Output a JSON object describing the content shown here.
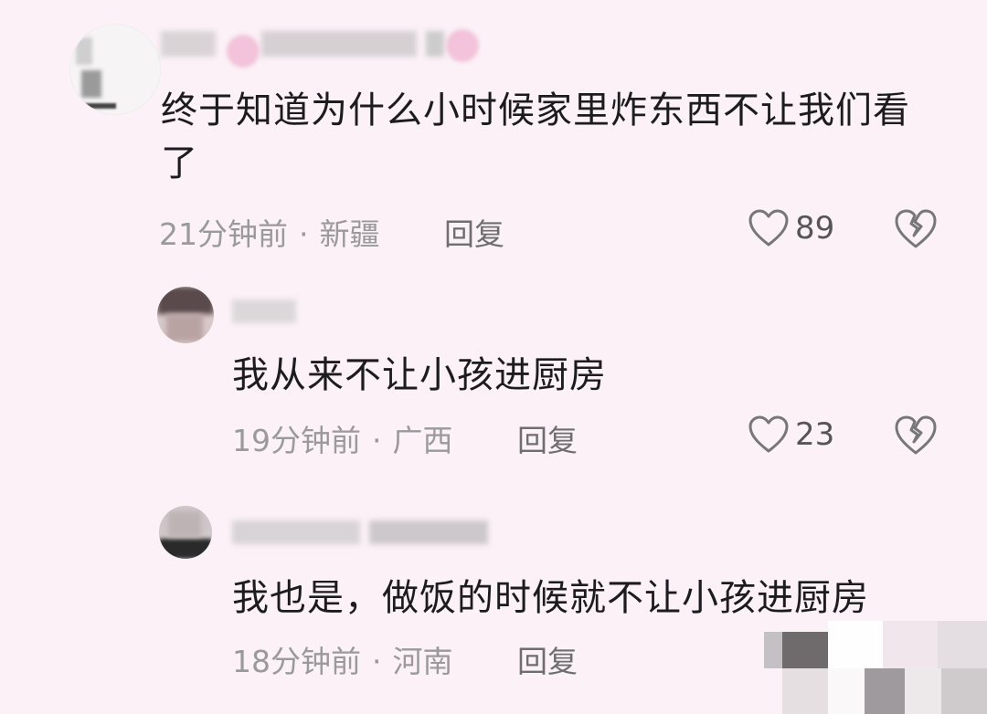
{
  "comments": [
    {
      "text": "终于知道为什么小时候家里炸东西不让我们看了",
      "time": "21分钟前",
      "location": "新疆",
      "reply_label": "回复",
      "likes": "89"
    },
    {
      "text": "我从来不让小孩进厨房",
      "time": "19分钟前",
      "location": "广西",
      "reply_label": "回复",
      "likes": "23"
    },
    {
      "text": "我也是，做饭的时候就不让小孩进厨房",
      "time": "18分钟前",
      "location": "河南",
      "reply_label": "回复"
    }
  ],
  "separator": "·",
  "icons": {
    "like": "heart-outline-icon",
    "dislike": "broken-heart-icon"
  },
  "colors": {
    "background": "#fbf1f6",
    "text": "#1c1c1c",
    "meta": "#9a9a9a",
    "icon": "#777777"
  }
}
